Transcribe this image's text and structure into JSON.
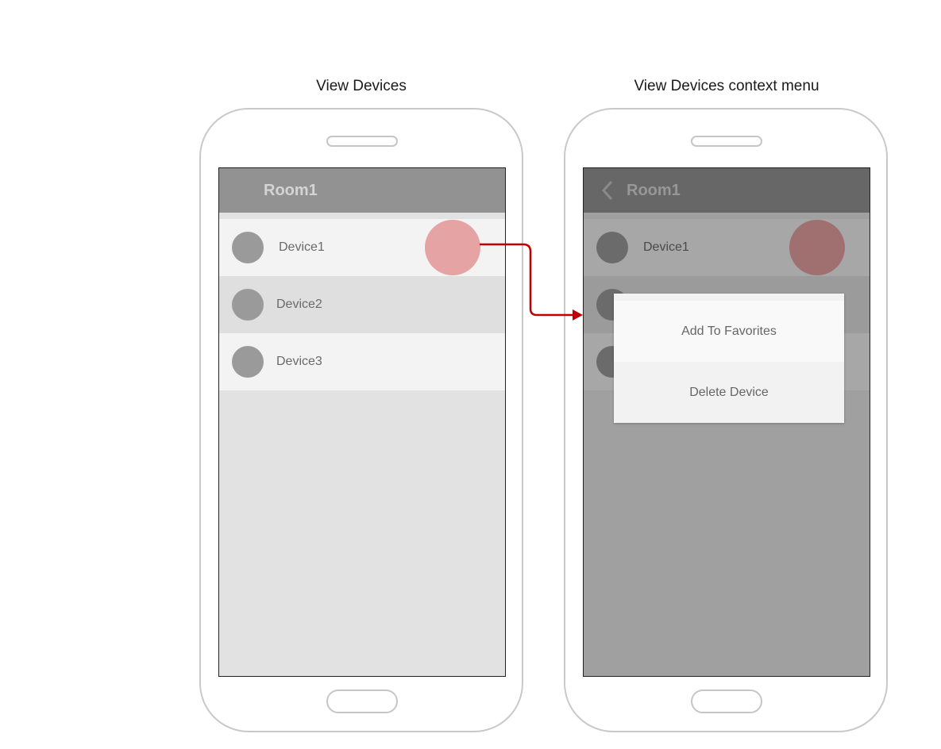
{
  "captions": {
    "left": "View Devices",
    "right": "View Devices context menu"
  },
  "left_screen": {
    "title": "Room1",
    "devices": [
      "Device1",
      "Device2",
      "Device3"
    ]
  },
  "right_screen": {
    "title": "Room1",
    "back_icon": "chevron-left-icon",
    "devices": [
      "Device1"
    ],
    "context_menu": {
      "items": [
        "Add To Favorites",
        "Delete Device"
      ]
    }
  },
  "colors": {
    "arrow": "#c00000",
    "touch_indicator": "#e6a3a3"
  }
}
